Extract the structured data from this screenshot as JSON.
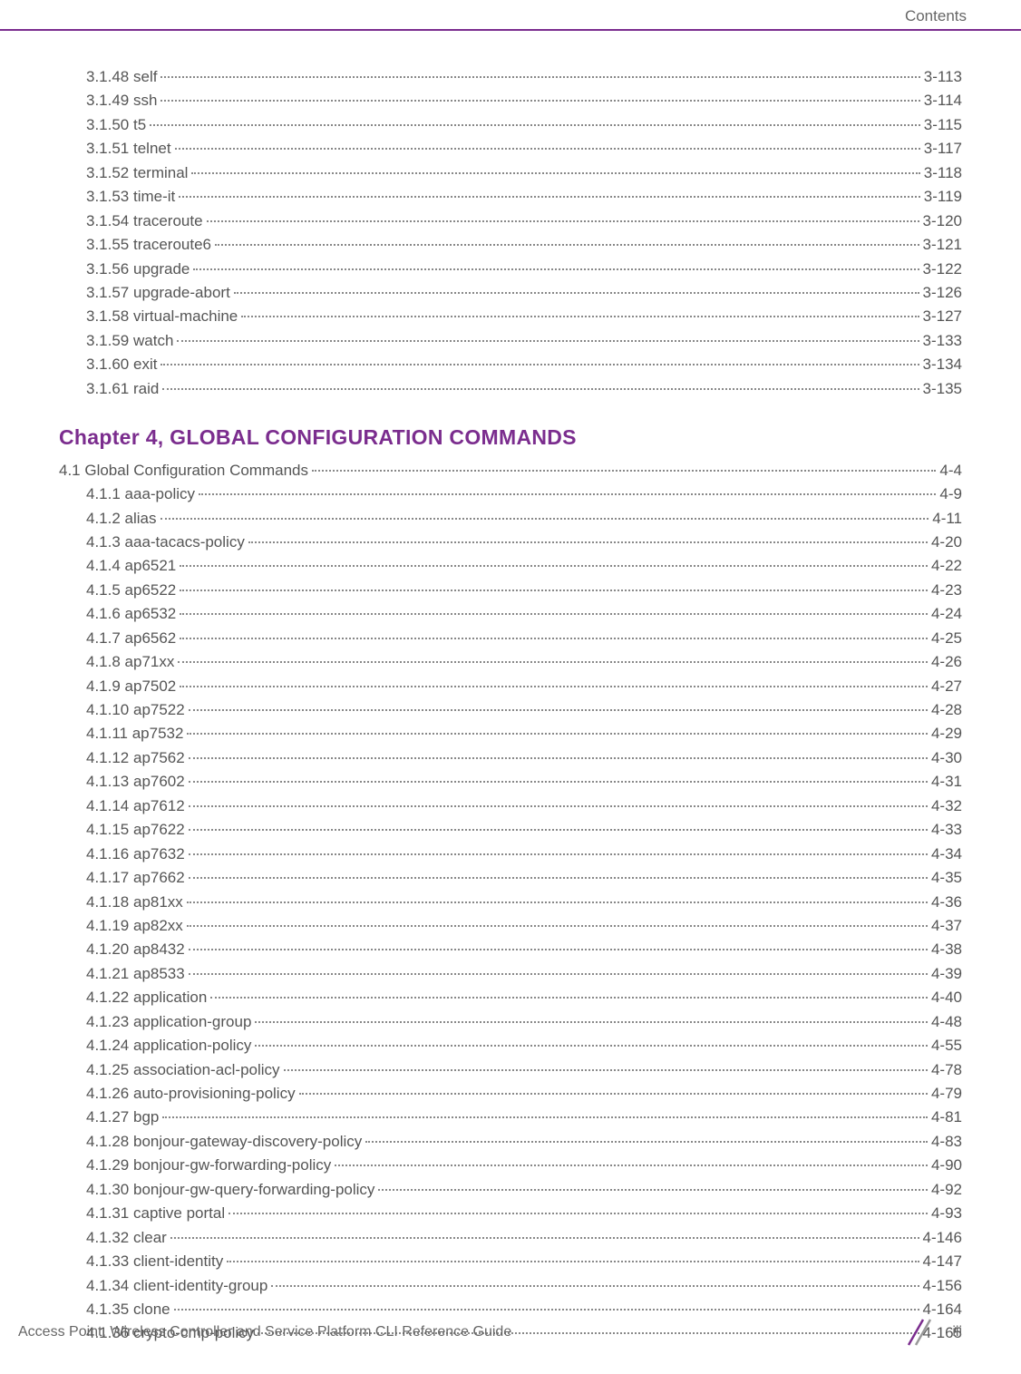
{
  "header": {
    "label": "Contents"
  },
  "chapter": {
    "title": "Chapter 4, GLOBAL CONFIGURATION COMMANDS"
  },
  "section3_entries": [
    {
      "num": "3.1.48",
      "title": "self",
      "page": "3-113"
    },
    {
      "num": "3.1.49",
      "title": "ssh",
      "page": "3-114"
    },
    {
      "num": "3.1.50",
      "title": "t5",
      "page": "3-115"
    },
    {
      "num": "3.1.51",
      "title": "telnet",
      "page": "3-117"
    },
    {
      "num": "3.1.52",
      "title": "terminal",
      "page": "3-118"
    },
    {
      "num": "3.1.53",
      "title": "time-it",
      "page": "3-119"
    },
    {
      "num": "3.1.54",
      "title": "traceroute",
      "page": "3-120"
    },
    {
      "num": "3.1.55",
      "title": "traceroute6",
      "page": "3-121"
    },
    {
      "num": "3.1.56",
      "title": "upgrade",
      "page": "3-122"
    },
    {
      "num": "3.1.57",
      "title": "upgrade-abort",
      "page": "3-126"
    },
    {
      "num": "3.1.58",
      "title": "virtual-machine",
      "page": "3-127"
    },
    {
      "num": "3.1.59",
      "title": "watch",
      "page": "3-133"
    },
    {
      "num": "3.1.60",
      "title": "exit",
      "page": "3-134"
    },
    {
      "num": "3.1.61",
      "title": "raid",
      "page": "3-135"
    }
  ],
  "section4_top": {
    "num": "4.1",
    "title": "Global Configuration Commands",
    "page": "4-4"
  },
  "section4_entries": [
    {
      "num": "4.1.1",
      "title": "aaa-policy",
      "page": "4-9"
    },
    {
      "num": "4.1.2",
      "title": "alias",
      "page": "4-11"
    },
    {
      "num": "4.1.3",
      "title": "aaa-tacacs-policy",
      "page": "4-20"
    },
    {
      "num": "4.1.4",
      "title": "ap6521",
      "page": "4-22"
    },
    {
      "num": "4.1.5",
      "title": "ap6522",
      "page": "4-23"
    },
    {
      "num": "4.1.6",
      "title": "ap6532",
      "page": "4-24"
    },
    {
      "num": "4.1.7",
      "title": "ap6562",
      "page": "4-25"
    },
    {
      "num": "4.1.8",
      "title": "ap71xx",
      "page": "4-26"
    },
    {
      "num": "4.1.9",
      "title": "ap7502",
      "page": "4-27"
    },
    {
      "num": "4.1.10",
      "title": "ap7522",
      "page": "4-28"
    },
    {
      "num": "4.1.11",
      "title": "ap7532",
      "page": "4-29"
    },
    {
      "num": "4.1.12",
      "title": "ap7562",
      "page": "4-30"
    },
    {
      "num": "4.1.13",
      "title": "ap7602",
      "page": "4-31"
    },
    {
      "num": "4.1.14",
      "title": "ap7612",
      "page": "4-32"
    },
    {
      "num": "4.1.15",
      "title": "ap7622",
      "page": "4-33"
    },
    {
      "num": "4.1.16",
      "title": "ap7632",
      "page": "4-34"
    },
    {
      "num": "4.1.17",
      "title": "ap7662",
      "page": "4-35"
    },
    {
      "num": "4.1.18",
      "title": "ap81xx",
      "page": "4-36"
    },
    {
      "num": "4.1.19",
      "title": "ap82xx",
      "page": "4-37"
    },
    {
      "num": "4.1.20",
      "title": "ap8432",
      "page": "4-38"
    },
    {
      "num": "4.1.21",
      "title": "ap8533",
      "page": "4-39"
    },
    {
      "num": "4.1.22",
      "title": "application",
      "page": "4-40"
    },
    {
      "num": "4.1.23",
      "title": "application-group",
      "page": "4-48"
    },
    {
      "num": "4.1.24",
      "title": "application-policy",
      "page": "4-55"
    },
    {
      "num": "4.1.25",
      "title": "association-acl-policy",
      "page": "4-78"
    },
    {
      "num": "4.1.26",
      "title": "auto-provisioning-policy",
      "page": "4-79"
    },
    {
      "num": "4.1.27",
      "title": "bgp",
      "page": "4-81"
    },
    {
      "num": "4.1.28",
      "title": "bonjour-gateway-discovery-policy",
      "page": "4-83"
    },
    {
      "num": "4.1.29",
      "title": "bonjour-gw-forwarding-policy",
      "page": "4-90"
    },
    {
      "num": "4.1.30",
      "title": "bonjour-gw-query-forwarding-policy",
      "page": "4-92"
    },
    {
      "num": "4.1.31",
      "title": "captive portal",
      "page": "4-93"
    },
    {
      "num": "4.1.32",
      "title": "clear",
      "page": "4-146"
    },
    {
      "num": "4.1.33",
      "title": "client-identity",
      "page": "4-147"
    },
    {
      "num": "4.1.34",
      "title": "client-identity-group",
      "page": "4-156"
    },
    {
      "num": "4.1.35",
      "title": "clone",
      "page": "4-164"
    },
    {
      "num": "4.1.36",
      "title": "crypto-cmp-policy",
      "page": "4-165"
    }
  ],
  "footer": {
    "text": "Access Point, Wireless Controller and Service Platform CLI Reference Guide",
    "page": "iii"
  }
}
